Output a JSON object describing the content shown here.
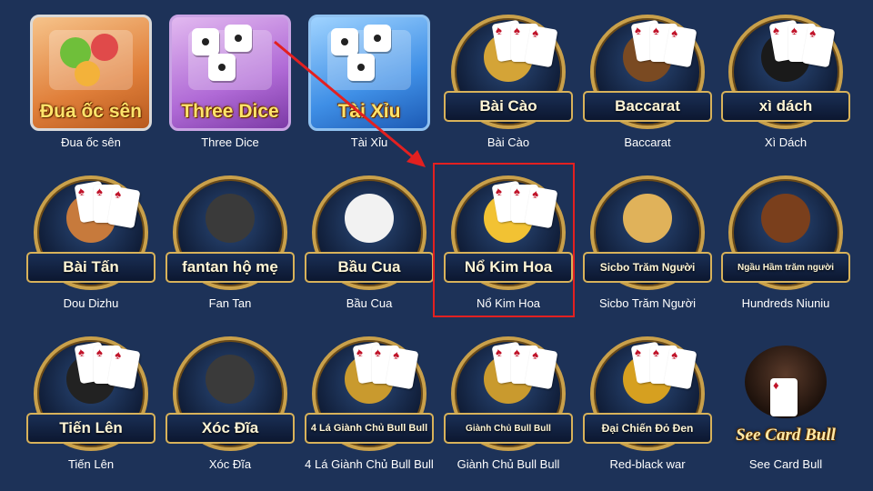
{
  "highlight_color": "#e32020",
  "arrow_color": "#e32020",
  "games": [
    {
      "id": "dua-oc-sen",
      "icon_label": "Đua ốc sên",
      "caption": "Đua ốc sên",
      "style": "square-orange",
      "art": "snail-icon"
    },
    {
      "id": "three-dice",
      "icon_label": "Three Dice",
      "caption": "Three Dice",
      "style": "square-purple",
      "art": "dice-icon"
    },
    {
      "id": "tai-xiu",
      "icon_label": "Tài Xỉu",
      "caption": "Tài Xỉu",
      "style": "square-blue",
      "art": "dice-icon"
    },
    {
      "id": "bai-cao",
      "icon_label": "Bài Cào",
      "caption": "Bài Cào",
      "style": "circle",
      "art": "cards-icon"
    },
    {
      "id": "baccarat",
      "icon_label": "Baccarat",
      "caption": "Baccarat",
      "style": "circle",
      "art": "roulette-icon"
    },
    {
      "id": "xi-dach",
      "icon_label": "xì dách",
      "caption": "Xì Dách",
      "style": "circle",
      "art": "hat-icon"
    },
    {
      "id": "bai-tan",
      "icon_label": "Bài Tấn",
      "caption": "Dou Dizhu",
      "style": "circle",
      "art": "character-icon"
    },
    {
      "id": "fantan",
      "icon_label": "fantan hộ mẹ",
      "caption": "Fan Tan",
      "style": "circle",
      "art": "bowl-icon"
    },
    {
      "id": "bau-cua",
      "icon_label": "Bầu Cua",
      "caption": "Bầu Cua",
      "style": "circle",
      "art": "dice-icon"
    },
    {
      "id": "no-kim-hoa",
      "icon_label": "Nổ Kim Hoa",
      "caption": "Nổ Kim Hoa",
      "style": "circle",
      "art": "flower-icon"
    },
    {
      "id": "sicbo",
      "icon_label": "Sicbo Trăm Người",
      "caption": "Sicbo Trăm Người",
      "style": "circle",
      "art": "dice-cup-icon"
    },
    {
      "id": "hundreds-niuniu",
      "icon_label": "Ngầu Hầm trăm người",
      "caption": "Hundreds Niuniu",
      "style": "circle",
      "art": "cowboy-hat-icon"
    },
    {
      "id": "tien-len",
      "icon_label": "Tiến Lên",
      "caption": "Tiến Lên",
      "style": "circle",
      "art": "bomb-icon"
    },
    {
      "id": "xoc-dia",
      "icon_label": "Xóc Đĩa",
      "caption": "Xóc Đĩa",
      "style": "circle",
      "art": "bowl-icon"
    },
    {
      "id": "4-la",
      "icon_label": "4 Lá Giành Chủ Bull Bull",
      "caption": "4 Lá Giành Chủ Bull Bull",
      "style": "circle",
      "art": "bull-icon"
    },
    {
      "id": "gianh-chu",
      "icon_label": "Giành Chủ Bull Bull",
      "caption": "Giành Chủ Bull Bull",
      "style": "circle",
      "art": "bull-icon"
    },
    {
      "id": "red-black",
      "icon_label": "Đại Chiến Đỏ Đen",
      "caption": "Red-black war",
      "style": "circle",
      "art": "vs-icon"
    },
    {
      "id": "see-card-bull",
      "icon_label": "See Card Bull",
      "caption": "See Card Bull",
      "style": "plain",
      "art": "bull-icon"
    }
  ]
}
